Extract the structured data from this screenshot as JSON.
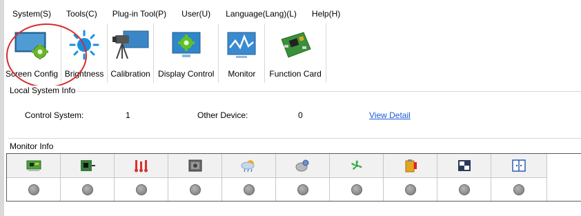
{
  "menu": [
    {
      "label": "System(S)"
    },
    {
      "label": "Tools(C)"
    },
    {
      "label": "Plug-in Tool(P)"
    },
    {
      "label": "User(U)"
    },
    {
      "label": "Language(Lang)(L)"
    },
    {
      "label": "Help(H)"
    }
  ],
  "toolbar": [
    {
      "label": "Screen Config",
      "icon": "screen-config-icon"
    },
    {
      "label": "Brightness",
      "icon": "sun-icon"
    },
    {
      "label": "Calibration",
      "icon": "camera-tripod-icon"
    },
    {
      "label": "Display Control",
      "icon": "display-gear-icon"
    },
    {
      "label": "Monitor",
      "icon": "monitor-signal-icon"
    },
    {
      "label": "Function Card",
      "icon": "circuit-board-icon"
    }
  ],
  "local_system": {
    "title": "Local System Info",
    "control_label": "Control System:",
    "control_value": "1",
    "other_label": "Other Device:",
    "other_value": "0",
    "view_detail": "View Detail"
  },
  "monitor": {
    "title": "Monitor Info",
    "columns": [
      {
        "icon": "receiving-card-icon"
      },
      {
        "icon": "board-chip-icon"
      },
      {
        "icon": "thermometer-icon"
      },
      {
        "icon": "cabinet-icon"
      },
      {
        "icon": "weather-humidity-icon"
      },
      {
        "icon": "smoke-sensor-icon"
      },
      {
        "icon": "fan-icon"
      },
      {
        "icon": "power-supply-icon"
      },
      {
        "icon": "module-flat-cable-icon"
      },
      {
        "icon": "door-icon"
      }
    ]
  },
  "colors": {
    "highlight_circle": "#d62b2b",
    "link": "#1a5bd6",
    "status_dot": "#8a8a8a"
  }
}
